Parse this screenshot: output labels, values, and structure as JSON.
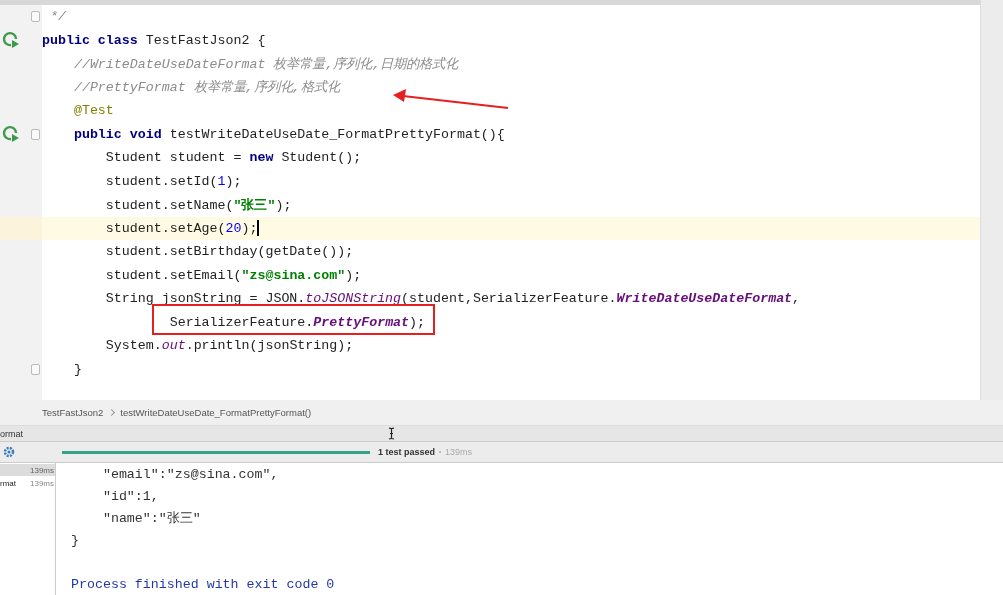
{
  "editor": {
    "lines": [
      {
        "run_icon": false,
        "fold": true,
        "current": false,
        "tokens": [
          {
            "kind": "comment",
            "text": " */"
          }
        ]
      },
      {
        "run_icon": true,
        "fold": false,
        "current": false,
        "tokens": [
          {
            "kind": "keyword",
            "text": "public class "
          },
          {
            "kind": "plain",
            "text": "TestFastJson2 {"
          }
        ]
      },
      {
        "run_icon": false,
        "fold": false,
        "current": false,
        "tokens": [
          {
            "kind": "comment",
            "text": "    //WriteDateUseDateFormat 枚举常量,序列化,日期的格式化"
          }
        ]
      },
      {
        "run_icon": false,
        "fold": false,
        "current": false,
        "tokens": [
          {
            "kind": "comment",
            "text": "    //PrettyFormat 枚举常量,序列化,格式化"
          }
        ]
      },
      {
        "run_icon": false,
        "fold": false,
        "current": false,
        "tokens": [
          {
            "kind": "annotation",
            "text": "    @Test"
          }
        ]
      },
      {
        "run_icon": true,
        "fold": true,
        "current": false,
        "tokens": [
          {
            "kind": "keyword",
            "text": "    public void "
          },
          {
            "kind": "plain",
            "text": "testWriteDateUseDate_FormatPrettyFormat(){"
          }
        ]
      },
      {
        "run_icon": false,
        "fold": false,
        "current": false,
        "tokens": [
          {
            "kind": "plain",
            "text": "        Student student = "
          },
          {
            "kind": "keyword",
            "text": "new "
          },
          {
            "kind": "plain",
            "text": "Student();"
          }
        ]
      },
      {
        "run_icon": false,
        "fold": false,
        "current": false,
        "tokens": [
          {
            "kind": "plain",
            "text": "        student.setId("
          },
          {
            "kind": "number",
            "text": "1"
          },
          {
            "kind": "plain",
            "text": ");"
          }
        ]
      },
      {
        "run_icon": false,
        "fold": false,
        "current": false,
        "tokens": [
          {
            "kind": "plain",
            "text": "        student.setName("
          },
          {
            "kind": "string",
            "text": "\"张三\""
          },
          {
            "kind": "plain",
            "text": ");"
          }
        ]
      },
      {
        "run_icon": false,
        "fold": false,
        "current": true,
        "tokens": [
          {
            "kind": "plain",
            "text": "        student.setAge("
          },
          {
            "kind": "number",
            "text": "20"
          },
          {
            "kind": "plain",
            "text": ");"
          }
        ]
      },
      {
        "run_icon": false,
        "fold": false,
        "current": false,
        "tokens": [
          {
            "kind": "plain",
            "text": "        student.setBirthday(getDate());"
          }
        ]
      },
      {
        "run_icon": false,
        "fold": false,
        "current": false,
        "tokens": [
          {
            "kind": "plain",
            "text": "        student.setEmail("
          },
          {
            "kind": "string",
            "text": "\"zs@sina.com\""
          },
          {
            "kind": "plain",
            "text": ");"
          }
        ]
      },
      {
        "run_icon": false,
        "fold": false,
        "current": false,
        "tokens": [
          {
            "kind": "plain",
            "text": "        String jsonString = JSON."
          },
          {
            "kind": "static",
            "text": "toJSONString"
          },
          {
            "kind": "plain",
            "text": "(student,SerializerFeature."
          },
          {
            "kind": "constant",
            "text": "WriteDateUseDateFormat"
          },
          {
            "kind": "plain",
            "text": ","
          }
        ]
      },
      {
        "run_icon": false,
        "fold": false,
        "current": false,
        "tokens": [
          {
            "kind": "plain",
            "text": "                SerializerFeature."
          },
          {
            "kind": "constant",
            "text": "PrettyFormat"
          },
          {
            "kind": "plain",
            "text": ");"
          }
        ]
      },
      {
        "run_icon": false,
        "fold": false,
        "current": false,
        "tokens": [
          {
            "kind": "plain",
            "text": "        System."
          },
          {
            "kind": "static",
            "text": "out"
          },
          {
            "kind": "plain",
            "text": ".println(jsonString);"
          }
        ]
      },
      {
        "run_icon": false,
        "fold": true,
        "current": false,
        "tokens": [
          {
            "kind": "plain",
            "text": "    }"
          }
        ]
      }
    ]
  },
  "breadcrumbs": [
    "TestFastJson2",
    "testWriteDateUseDate_FormatPrettyFormat()"
  ],
  "run_panel": {
    "title": "ormat",
    "progress": {
      "level": 1.0
    },
    "status": "1 test passed",
    "duration": "139ms",
    "tests": [
      {
        "time": "139ms",
        "selected": true
      },
      {
        "name": "rmat",
        "time": "139ms",
        "selected": false
      }
    ],
    "console": [
      {
        "kind": "output",
        "text": "    \"email\":\"zs@sina.com\","
      },
      {
        "kind": "output",
        "text": "    \"id\":1,"
      },
      {
        "kind": "output",
        "text": "    \"name\":\"张三\""
      },
      {
        "kind": "output",
        "text": "}"
      },
      {
        "kind": "blank"
      },
      {
        "kind": "exit",
        "text": "Process finished with exit code 0"
      }
    ]
  }
}
